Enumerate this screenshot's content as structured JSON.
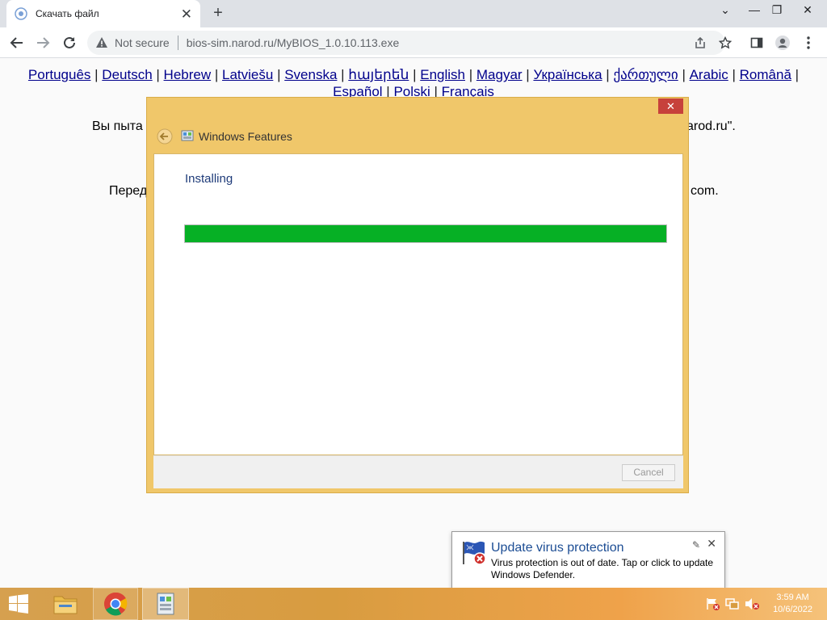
{
  "browser": {
    "tab_title": "Скачать файл",
    "new_tab": "+",
    "tab_close": "✕",
    "omnibox": {
      "security": "Not secure",
      "url": "bios-sim.narod.ru/MyBIOS_1.0.10.113.exe"
    },
    "window_controls": {
      "minimize": "⌄",
      "min": "—",
      "restore": "❐",
      "close": "✕"
    }
  },
  "page": {
    "languages": [
      "Português",
      "Deutsch",
      "Hebrew",
      "Latviešu",
      "Svenska",
      "հայերեն",
      "English",
      "Magyar",
      "Українська",
      "ქართული",
      "Arabic",
      "Română",
      "Español",
      "Polski",
      "Français"
    ],
    "separator": " | ",
    "text_left_1": "Вы пыта",
    "text_right_1": "arod.ru\".",
    "text_left_2": "Перед",
    "text_right_2": "com."
  },
  "dialog": {
    "title": "Windows Features",
    "close": "✕",
    "status": "Installing",
    "progress": 1.0,
    "cancel_label": "Cancel",
    "colors": {
      "frame": "#f0c76a",
      "progress": "#06b025"
    }
  },
  "toast": {
    "title": "Update virus protection",
    "message": "Virus protection is out of date. Tap or click to update Windows Defender.",
    "pin": "✎",
    "close": "✕"
  },
  "taskbar": {
    "clock_time": "3:59 AM",
    "clock_date": "10/6/2022",
    "items": [
      "start-icon",
      "file-explorer-icon",
      "chrome-icon",
      "windows-features-icon"
    ]
  }
}
